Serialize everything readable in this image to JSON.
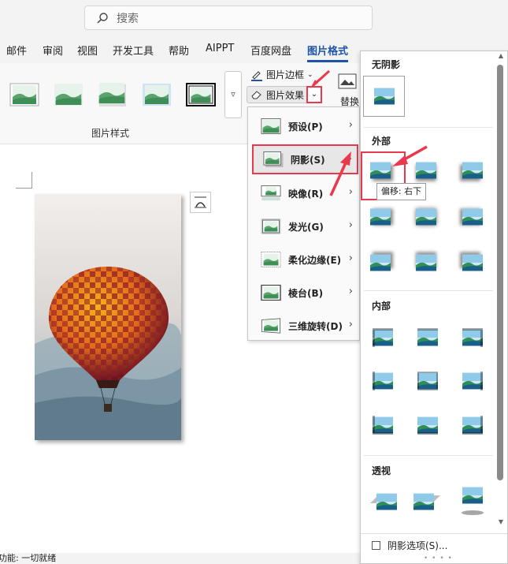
{
  "search": {
    "placeholder": "搜索"
  },
  "tabs": [
    {
      "label": "邮件"
    },
    {
      "label": "审阅"
    },
    {
      "label": "视图"
    },
    {
      "label": "开发工具"
    },
    {
      "label": "帮助"
    },
    {
      "label": "AIPPT"
    },
    {
      "label": "百度网盘"
    },
    {
      "label": "图片格式"
    }
  ],
  "ribbon": {
    "picture_styles_label": "图片样式",
    "picture_border": "图片边框",
    "picture_effects": "图片效果",
    "replace": "替换"
  },
  "effects_menu": {
    "items": [
      {
        "label": "预设(P)"
      },
      {
        "label": "阴影(S)"
      },
      {
        "label": "映像(R)"
      },
      {
        "label": "发光(G)"
      },
      {
        "label": "柔化边缘(E)"
      },
      {
        "label": "棱台(B)"
      },
      {
        "label": "三维旋转(D)"
      }
    ]
  },
  "shadow_panel": {
    "no_shadow": "无阴影",
    "outer": "外部",
    "inner": "内部",
    "perspective": "透视",
    "tooltip": "偏移: 右下",
    "options": "阴影选项(S)..."
  },
  "status": {
    "text": "功能: 一切就绪"
  },
  "colors": {
    "accent": "#1f54a8",
    "highlight": "#e8394d"
  }
}
